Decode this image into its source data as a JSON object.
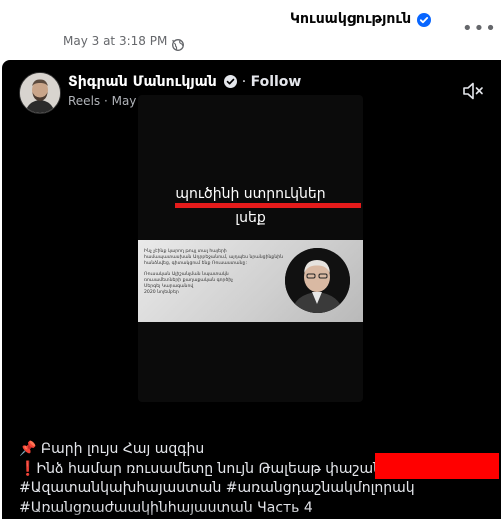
{
  "page": {
    "name": "Կուսակցություն",
    "meta_date": "May 3 at 3:18 PM",
    "meta_sep": "·"
  },
  "post": {
    "author": "Տիգրան Մանուկյան",
    "follow_sep": "·",
    "follow_label": "Follow",
    "reels_meta": "Reels · May 2 ·"
  },
  "video": {
    "line1": "պուծինի ստրուկներ",
    "line2": "լսեք",
    "quote_lines": [
      "Ինչ չէինք կարող թույլ տալ հայերի",
      "համապատասխան Ադրբեջանում, այդպես նրանցինքնին",
      "հանձնվեց, գիտակցում ենք Ռուսաստանը:",
      "",
      "Ռուսական Ալիշանլման նպատակն",
      "ռուսամետների քաղաքական գործիչ",
      "Սերգեյ Կարագանով",
      "2020 նոյեմբեր"
    ]
  },
  "caption": [
    "📌 Բարի լույս Հայ ազգիս",
    "❗Ինձ համար ռուսամետը նույն Թալեաթ փաշան է:",
    "#Ազատանկախհայաստան #առանցդաշնակմոլորակ",
    "#Առանցռաժաակինհայաստան Часть 4"
  ],
  "colors": {
    "redaction": "#ff0000",
    "underline": "#e51b1b",
    "verified": "#0866ff"
  },
  "icons": [
    "verified-badge-icon",
    "more-icon",
    "globe-icon",
    "speaker-muted-icon",
    "pin-icon"
  ]
}
